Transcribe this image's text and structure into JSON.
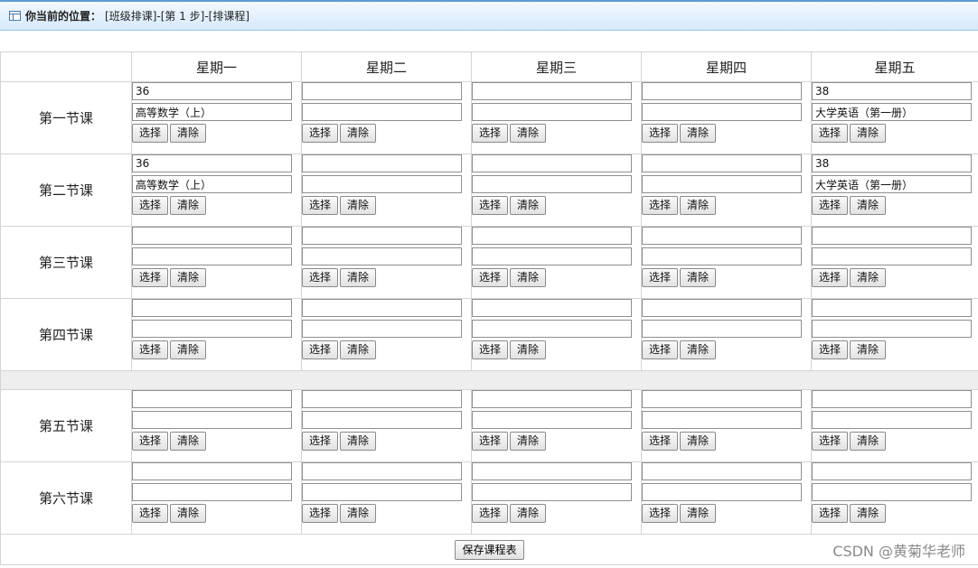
{
  "breadcrumb": {
    "label": "你当前的位置：",
    "path": "[班级排课]-[第 1 步]-[排课程]"
  },
  "days": [
    "星期一",
    "星期二",
    "星期三",
    "星期四",
    "星期五"
  ],
  "buttons": {
    "select": "选择",
    "clear": "清除",
    "save": "保存课程表"
  },
  "periods": [
    {
      "label": "第一节课",
      "cells": [
        {
          "code": "36",
          "course": "高等数学（上）"
        },
        {
          "code": "",
          "course": ""
        },
        {
          "code": "",
          "course": ""
        },
        {
          "code": "",
          "course": ""
        },
        {
          "code": "38",
          "course": "大学英语（第一册）"
        }
      ]
    },
    {
      "label": "第二节课",
      "cells": [
        {
          "code": "36",
          "course": "高等数学（上）"
        },
        {
          "code": "",
          "course": ""
        },
        {
          "code": "",
          "course": ""
        },
        {
          "code": "",
          "course": ""
        },
        {
          "code": "38",
          "course": "大学英语（第一册）"
        }
      ]
    },
    {
      "label": "第三节课",
      "cells": [
        {
          "code": "",
          "course": ""
        },
        {
          "code": "",
          "course": ""
        },
        {
          "code": "",
          "course": ""
        },
        {
          "code": "",
          "course": ""
        },
        {
          "code": "",
          "course": ""
        }
      ]
    },
    {
      "label": "第四节课",
      "cells": [
        {
          "code": "",
          "course": ""
        },
        {
          "code": "",
          "course": ""
        },
        {
          "code": "",
          "course": ""
        },
        {
          "code": "",
          "course": ""
        },
        {
          "code": "",
          "course": ""
        }
      ]
    },
    {
      "label": "第五节课",
      "cells": [
        {
          "code": "",
          "course": ""
        },
        {
          "code": "",
          "course": ""
        },
        {
          "code": "",
          "course": ""
        },
        {
          "code": "",
          "course": ""
        },
        {
          "code": "",
          "course": ""
        }
      ]
    },
    {
      "label": "第六节课",
      "cells": [
        {
          "code": "",
          "course": ""
        },
        {
          "code": "",
          "course": ""
        },
        {
          "code": "",
          "course": ""
        },
        {
          "code": "",
          "course": ""
        },
        {
          "code": "",
          "course": ""
        }
      ]
    }
  ],
  "watermark": "CSDN @黄菊华老师"
}
